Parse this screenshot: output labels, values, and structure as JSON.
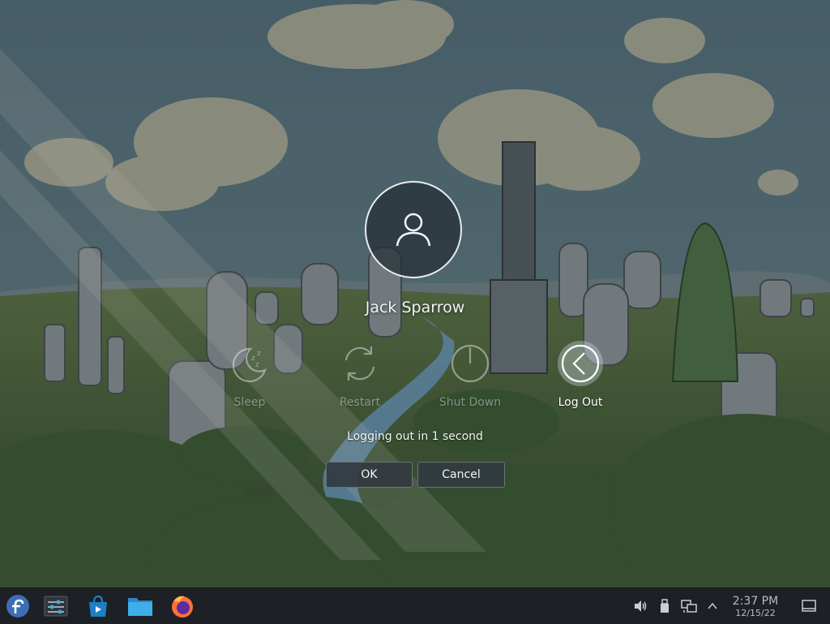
{
  "user": {
    "name": "Jack Sparrow",
    "avatar_icon": "user-icon"
  },
  "actions": [
    {
      "label": "Sleep",
      "icon": "moon-sleep-icon",
      "state": "dimmed"
    },
    {
      "label": "Restart",
      "icon": "restart-icon",
      "state": "dimmed"
    },
    {
      "label": "Shut Down",
      "icon": "power-icon",
      "state": "dimmed"
    },
    {
      "label": "Log Out",
      "icon": "chevron-left-icon",
      "state": "active"
    }
  ],
  "status": {
    "message": "Logging out in 1 second"
  },
  "buttons": {
    "ok_label": "OK",
    "cancel_label": "Cancel"
  },
  "taskbar": {
    "launchers": [
      {
        "icon": "fedora-logo-icon"
      },
      {
        "icon": "system-settings-icon"
      },
      {
        "icon": "software-center-icon"
      },
      {
        "icon": "file-manager-icon"
      },
      {
        "icon": "firefox-icon"
      }
    ],
    "tray": [
      {
        "icon": "volume-icon"
      },
      {
        "icon": "usb-device-icon"
      },
      {
        "icon": "network-icon"
      },
      {
        "icon": "chevron-up-icon"
      }
    ],
    "clock": {
      "time": "2:37 PM",
      "date": "12/15/22"
    },
    "show_desktop_icon": "show-desktop-icon"
  },
  "colors": {
    "taskbar_bg": "#1d2024",
    "accent": "#3daee9",
    "text": "#eef1f4"
  }
}
